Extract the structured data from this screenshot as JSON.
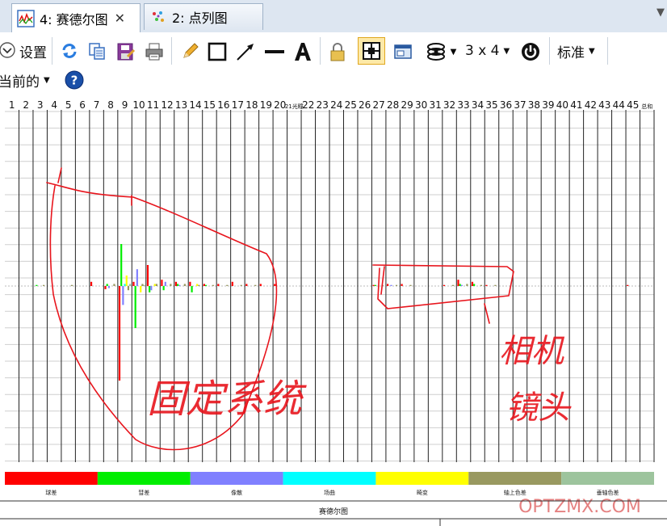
{
  "tabs": [
    {
      "label": "4: 赛德尔图",
      "close": "✕",
      "icon": "zernike-chart-icon"
    },
    {
      "label": "2: 点列图",
      "icon": "spot-diagram-icon"
    }
  ],
  "tab_menu_arrow": "▼",
  "toolbar": {
    "settings_label": "设置",
    "layout_label": "3 x 4",
    "standard_label": "标准",
    "current_label": "当前的"
  },
  "colors": {
    "bar_red": "#ff0000",
    "bar_green": "#00ee00",
    "bar_blue": "#8080ff",
    "bar_cyan": "#00ffff",
    "bar_yellow": "#ffff00",
    "bar_olive": "#999960",
    "bar_sage": "#9dc49d",
    "annotation": "#e8141c",
    "watermark": "#e06b6b"
  },
  "chart_data": {
    "type": "bar",
    "title": "赛德尔图",
    "categories": [
      "1",
      "2",
      "3",
      "4",
      "5",
      "6",
      "7",
      "8",
      "9",
      "10",
      "11",
      "12",
      "13",
      "14",
      "15",
      "16",
      "17",
      "18",
      "19",
      "20",
      "21",
      "22",
      "23",
      "24",
      "25",
      "26",
      "27",
      "28",
      "29",
      "30",
      "31",
      "32",
      "33",
      "34",
      "35",
      "36",
      "37",
      "38",
      "39",
      "40",
      "41",
      "42",
      "43",
      "44",
      "45"
    ],
    "last_category_label": "总和",
    "category_21_label": "21光瞳",
    "series": [
      {
        "name": "球差",
        "color": "#ff0000",
        "values": [
          0,
          0,
          0,
          0,
          0,
          0,
          0.2,
          -0.15,
          -4.5,
          0.2,
          1.0,
          0.3,
          0.2,
          0.2,
          0.1,
          0.1,
          0.2,
          0.1,
          0.1,
          0.1,
          0,
          0,
          0,
          0,
          0,
          0,
          0.05,
          0.1,
          0.1,
          0,
          0,
          0.05,
          0.3,
          0.2,
          0.05,
          0,
          0,
          0,
          0,
          0,
          0,
          0,
          0,
          0,
          0.05
        ]
      },
      {
        "name": "彗差",
        "color": "#00ee00",
        "values": [
          0,
          0,
          0.05,
          0,
          0,
          0,
          0,
          0.1,
          2.0,
          -2.0,
          -0.3,
          -0.2,
          0.1,
          -0.3,
          0.05,
          0,
          0,
          0,
          0,
          0,
          0,
          0,
          0,
          0,
          0,
          0,
          0.05,
          0,
          0,
          0,
          0,
          0,
          0.1,
          0.1,
          0,
          0,
          0,
          0,
          0,
          0,
          0,
          0,
          0,
          0,
          0
        ]
      },
      {
        "name": "像散",
        "color": "#8080ff",
        "values": [
          0,
          0,
          0,
          0,
          0,
          0,
          0,
          -0.1,
          -0.9,
          0.8,
          -0.2,
          0.2,
          0.05,
          0,
          0,
          0,
          0,
          0,
          0,
          0,
          0,
          0,
          0,
          0,
          0,
          0,
          0,
          0.05,
          0,
          0,
          0,
          0,
          0.05,
          0,
          0,
          0,
          0,
          0,
          0,
          0,
          0,
          0,
          0,
          0,
          0
        ]
      },
      {
        "name": "场曲",
        "color": "#00ffff",
        "values": [
          0,
          0,
          0,
          0,
          0,
          0,
          0,
          0,
          0.1,
          0,
          0,
          0,
          0,
          0,
          0,
          0,
          0,
          0,
          0,
          0,
          0,
          0,
          0,
          0,
          0,
          0,
          0,
          0,
          0,
          0,
          0,
          0,
          0,
          0,
          0,
          0,
          0,
          0,
          0,
          0,
          0,
          0,
          0,
          0,
          0
        ]
      },
      {
        "name": "畸变",
        "color": "#ffff00",
        "values": [
          0,
          0,
          0,
          0,
          0,
          0,
          0,
          0,
          0.5,
          -0.3,
          0.1,
          0,
          0,
          0.1,
          0,
          0,
          0,
          0,
          0,
          0,
          0,
          0,
          0,
          0,
          0,
          0,
          0,
          0,
          0,
          0,
          0,
          0,
          0,
          0,
          0,
          0,
          0,
          0,
          0,
          0,
          0,
          0,
          0,
          0,
          0
        ]
      },
      {
        "name": "轴上色差",
        "color": "#999960",
        "values": [
          0,
          0,
          0.05,
          0,
          0.05,
          0,
          0,
          0.1,
          -0.2,
          0.1,
          0.1,
          0.1,
          0.1,
          0.05,
          0.05,
          0.05,
          0.05,
          0.05,
          0,
          0,
          0,
          0,
          0,
          0,
          0,
          0,
          0.05,
          0.05,
          0.05,
          0,
          0,
          0.05,
          0.1,
          0.05,
          0.05,
          0,
          0,
          0,
          0,
          0,
          0,
          0,
          0,
          0,
          0
        ]
      },
      {
        "name": "垂轴色差",
        "color": "#9dc49d",
        "values": [
          0,
          0,
          0,
          0,
          0,
          0,
          0,
          0,
          0.1,
          0.05,
          0,
          0,
          0,
          0,
          0,
          0,
          0,
          0,
          0,
          0,
          0,
          0,
          0,
          0,
          0,
          0,
          0,
          0,
          0,
          0,
          0,
          0,
          0,
          0,
          0,
          0,
          0,
          0,
          0,
          0,
          0,
          0,
          0,
          0,
          0
        ]
      }
    ],
    "ylim": [
      -6,
      6
    ],
    "grid": true,
    "legend_position": "bottom"
  },
  "annotations": {
    "text_left": "固定系统",
    "text_right_1": "相机",
    "text_right_2": "镜头"
  },
  "watermark": "OPTZMX.COM"
}
